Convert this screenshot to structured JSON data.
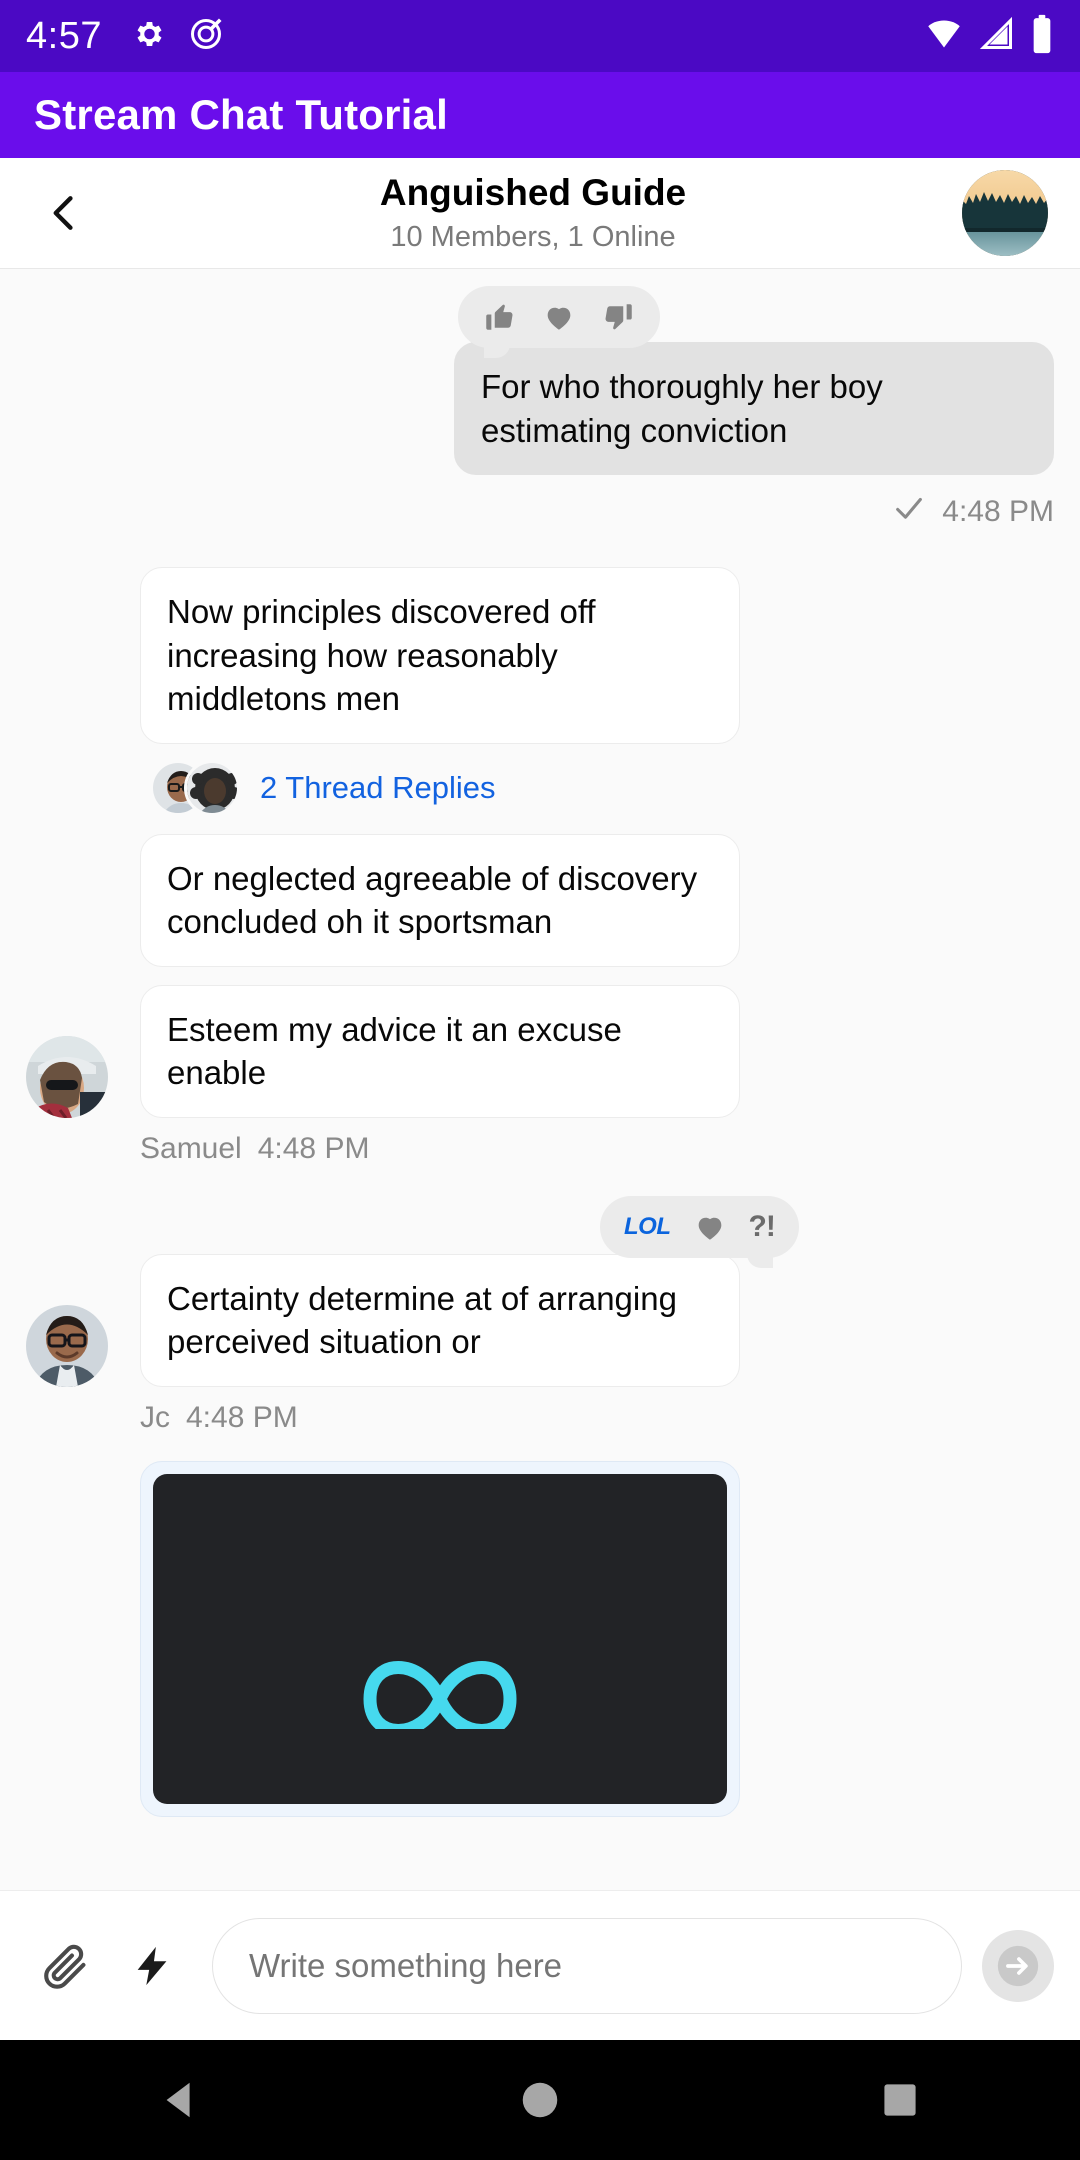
{
  "status_bar": {
    "clock": "4:57",
    "icons": [
      "gear-icon",
      "do-not-disturb-icon"
    ],
    "right_icons": [
      "wifi-icon",
      "cellular-signal-icon",
      "battery-icon"
    ]
  },
  "app_bar": {
    "title": "Stream Chat Tutorial",
    "background": "#6A0DEB"
  },
  "channel_header": {
    "back_icon": "chevron-left-icon",
    "title": "Anguished Guide",
    "subtitle": "10 Members, 1 Online",
    "avatar_alt": "forest-landscape-avatar"
  },
  "messages": [
    {
      "id": "m1",
      "side": "right",
      "text": "For who thoroughly her boy estimating conviction",
      "reactions": [
        "thumbs-up",
        "heart",
        "thumbs-down"
      ],
      "status_icon": "check-icon",
      "time": "4:48 PM"
    },
    {
      "id": "m2",
      "side": "left",
      "text": "Now principles discovered off increasing how reasonably middletons men",
      "thread": {
        "label": "2 Thread Replies",
        "count": 2,
        "color": "#1262e0"
      }
    },
    {
      "id": "m3",
      "side": "left",
      "text": "Or neglected agreeable of discovery concluded oh it sportsman"
    },
    {
      "id": "m4",
      "side": "left",
      "text": "Esteem my advice it an excuse enable",
      "sender": "Samuel",
      "time": "4:48 PM",
      "avatar_alt": "woman-sunglasses-cap-avatar"
    },
    {
      "id": "m5",
      "side": "left",
      "text": "Certainty determine at of arranging perceived situation or",
      "reactions": [
        "lol",
        "heart",
        "wut"
      ],
      "sender": "Jc",
      "time": "4:48 PM",
      "avatar_alt": "man-glasses-avatar"
    },
    {
      "id": "m6",
      "side": "left",
      "attachment": {
        "type": "video",
        "alt": "dark-card-with-cyan-infinity-logo"
      }
    }
  ],
  "reaction_glyphs": {
    "lol": "LOL",
    "wut": "?!"
  },
  "composer": {
    "attach_icon": "paperclip-icon",
    "command_icon": "lightning-bolt-icon",
    "placeholder": "Write something here",
    "value": "",
    "send_icon": "arrow-right-circle-icon"
  },
  "nav_bar": {
    "back_icon": "triangle-back-icon",
    "home_icon": "circle-home-icon",
    "recents_icon": "square-recents-icon"
  },
  "colors": {
    "status_bar": "#4B09C4",
    "app_bar": "#6A0DEB",
    "link": "#1262e0",
    "my_bubble": "#e2e2e2",
    "their_bubble": "#ffffff",
    "list_bg": "#fafafa"
  }
}
